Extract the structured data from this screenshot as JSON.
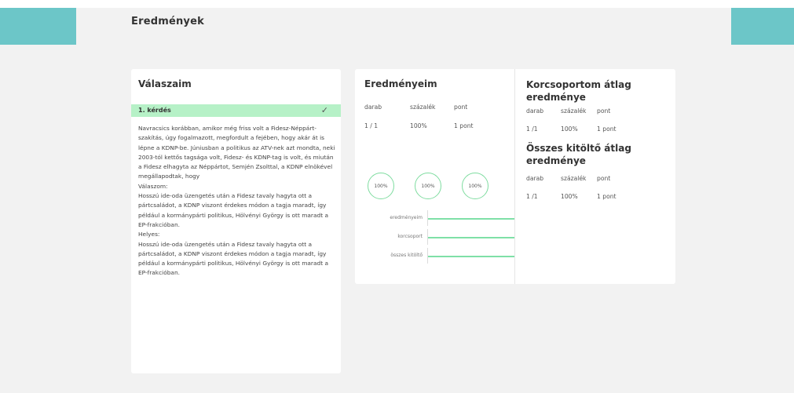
{
  "page": {
    "title": "Eredmények"
  },
  "colors": {
    "accent_teal": "#6cc6c8",
    "correct_green": "#b6f1c7",
    "bar_green": "#7fe0a7"
  },
  "answers": {
    "title": "Válaszaim",
    "question_label": "1. kérdés",
    "question_status_icon": "check-icon",
    "question_text": "Navracsics korábban, amikor még friss volt a Fidesz-Néppárt-szakítás, úgy fogalmazott, megfordult a fejében, hogy akár át is lépne a KDNP-be. Júniusban a politikus az ATV-nek azt mondta, neki 2003-tól kettős tagsága volt, Fidesz- és KDNP-tag is volt, és miután a Fidesz elhagyta az Néppártot, Semjén Zsolttal, a KDNP elnökével megállapodtak, hogy",
    "your_answer_label": "Válaszom:",
    "your_answer_text": "Hosszú ide-oda üzengetés után a Fidesz tavaly hagyta ott a pártcsaládot, a KDNP viszont érdekes módon a tagja maradt, így például a kormánypárti politikus, Hölvényi György is ott maradt a EP-frakcióban.",
    "correct_label": "Helyes:",
    "correct_text": "Hosszú ide-oda üzengetés után a Fidesz tavaly hagyta ott a pártcsaládot, a KDNP viszont érdekes módon a tagja maradt, így például a kormánypárti politikus, Hölvényi György is ott maradt a EP-frakcióban."
  },
  "my_results": {
    "title": "Eredményeim",
    "headers": [
      "darab",
      "százalék",
      "pont"
    ],
    "values": [
      "1 / 1",
      "100%",
      "1 pont"
    ],
    "circles": [
      "100%",
      "100%",
      "100%"
    ],
    "bars": [
      {
        "label": "eredményeim",
        "value": 1.0
      },
      {
        "label": "korcsoport",
        "value": 1.0
      },
      {
        "label": "összes kitöltő",
        "value": 1.0
      }
    ]
  },
  "age_group": {
    "title": "Korcsoportom átlag eredménye",
    "headers": [
      "darab",
      "százalék",
      "pont"
    ],
    "values": [
      "1 /1",
      "100%",
      "1 pont"
    ]
  },
  "all_respondents": {
    "title": "Összes kitöltő átlag eredménye",
    "headers": [
      "darab",
      "százalék",
      "pont"
    ],
    "values": [
      "1 /1",
      "100%",
      "1 pont"
    ]
  }
}
